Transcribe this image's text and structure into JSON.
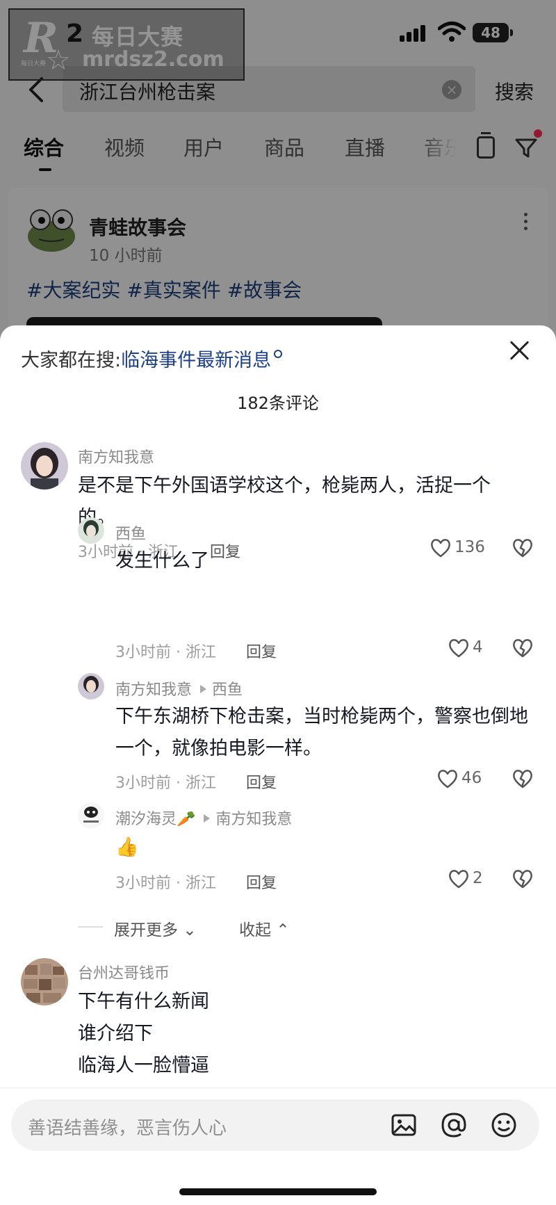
{
  "status_bar": {
    "time": "2",
    "battery": "48"
  },
  "watermark": {
    "logo_letter": "R",
    "small_text": "每日大赛",
    "title": "每日大赛",
    "url": "mrdsz2.com"
  },
  "search": {
    "query": "浙江台州枪击案",
    "button": "搜索"
  },
  "tabs": [
    "综合",
    "视频",
    "用户",
    "商品",
    "直播",
    "音乐"
  ],
  "post": {
    "author": "青蛙故事会",
    "time": "10 小时前",
    "tags": "#大案纪实 #真实案件 #故事会"
  },
  "sheet": {
    "hot_search_label": "大家都在搜:",
    "hot_search_link": "临海事件最新消息",
    "count_label": "182条评论"
  },
  "comments": [
    {
      "name": "南方知我意",
      "text_lines": [
        "是不是下午外国语学校这个，枪毙两人，活捉一个",
        "的。"
      ],
      "meta": "3小时前 · 浙江",
      "reply": "回复",
      "likes": "136"
    },
    {
      "name": "西鱼",
      "text_lines": [
        "发生什么了"
      ],
      "meta": "3小时前 · 浙江",
      "reply": "回复",
      "likes": "4"
    },
    {
      "name": "南方知我意",
      "reply_to": "西鱼",
      "text_lines": [
        "下午东湖桥下枪击案，当时枪毙两个，警察也倒地",
        "一个，就像拍电影一样。"
      ],
      "meta": "3小时前 · 浙江",
      "reply": "回复",
      "likes": "46"
    },
    {
      "name": "潮汐海灵🥕",
      "reply_to": "南方知我意",
      "text_lines": [
        "👍"
      ],
      "meta": "3小时前 · 浙江",
      "reply": "回复",
      "likes": "2"
    },
    {
      "name": "台州达哥钱币",
      "text_lines": [
        "下午有什么新闻",
        "谁介绍下",
        "临海人一脸懵逼"
      ]
    }
  ],
  "thread_controls": {
    "expand": "展开更多",
    "collapse": "收起"
  },
  "input": {
    "placeholder": "善语结善缘，恶言伤人心"
  },
  "colors": {
    "accent_red": "#fe2c55",
    "link_blue": "#1d3f8a",
    "background": "#ffffff"
  }
}
